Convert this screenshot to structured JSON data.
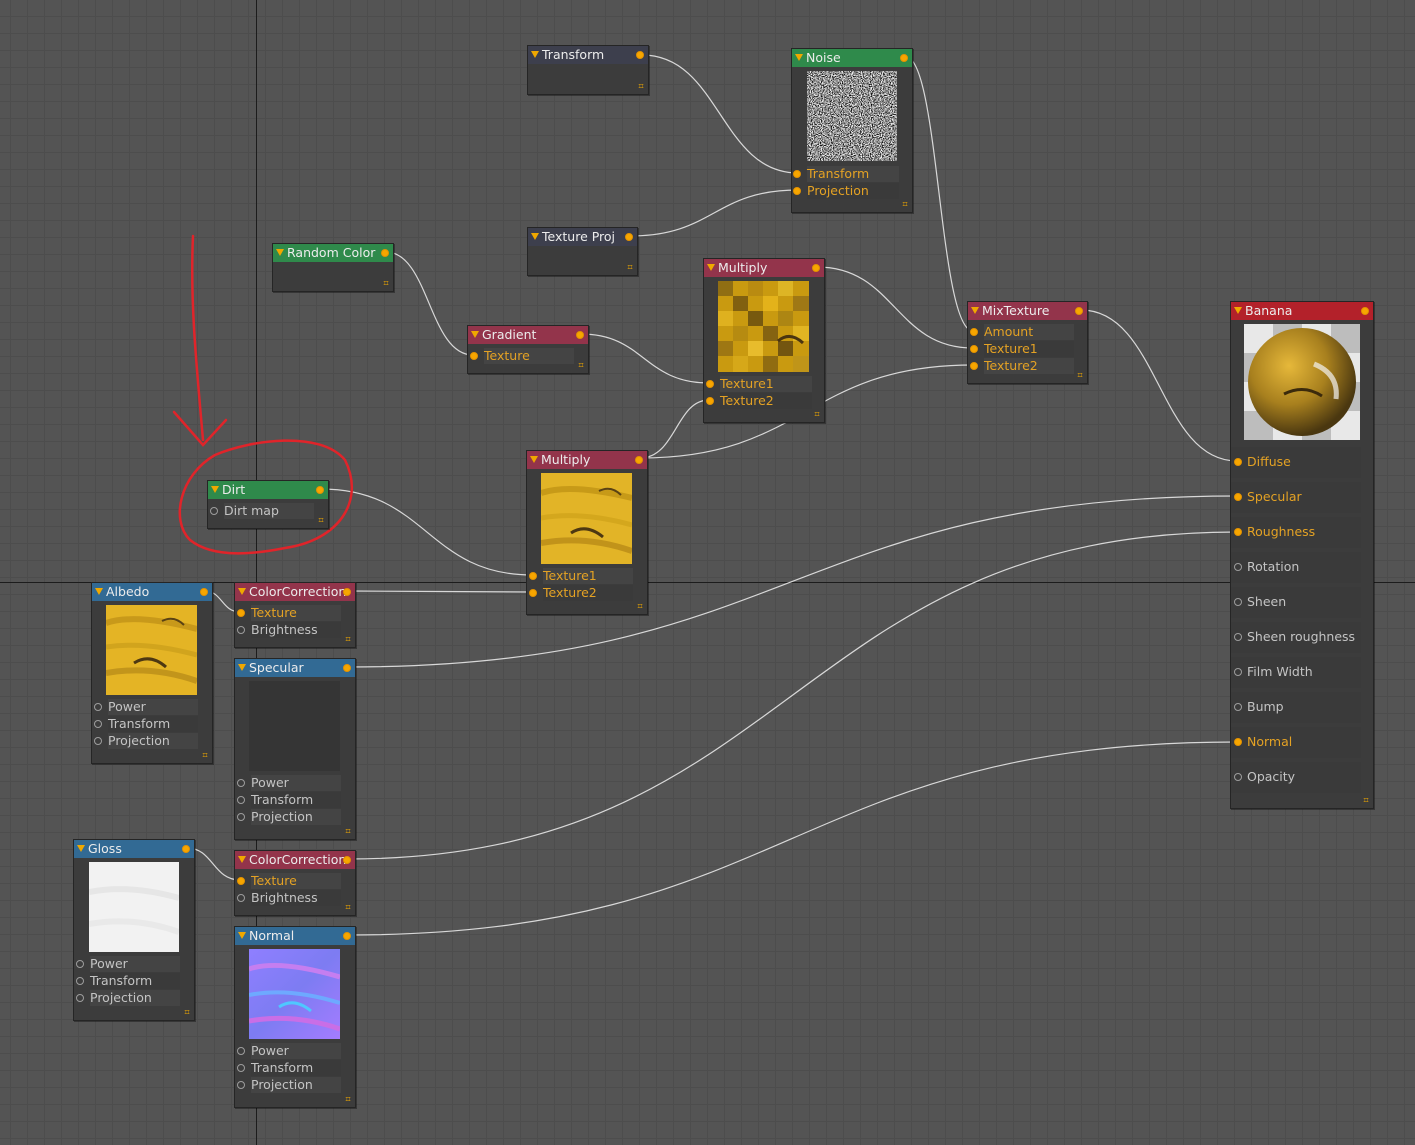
{
  "nodes": {
    "transform": {
      "title": "Transform"
    },
    "noise": {
      "title": "Noise",
      "ports": [
        "Transform",
        "Projection"
      ]
    },
    "texture_proj": {
      "title": "Texture Proj"
    },
    "random_color": {
      "title": "Random Color"
    },
    "gradient": {
      "title": "Gradient",
      "ports": [
        "Texture"
      ]
    },
    "multiply_top": {
      "title": "Multiply",
      "ports": [
        "Texture1",
        "Texture2"
      ]
    },
    "mix_texture": {
      "title": "MixTexture",
      "ports": [
        "Amount",
        "Texture1",
        "Texture2"
      ]
    },
    "dirt": {
      "title": "Dirt",
      "ports": [
        "Dirt map"
      ]
    },
    "multiply_mid": {
      "title": "Multiply",
      "ports": [
        "Texture1",
        "Texture2"
      ]
    },
    "albedo": {
      "title": "Albedo",
      "ports": [
        "Power",
        "Transform",
        "Projection"
      ]
    },
    "color_correction_1": {
      "title": "ColorCorrection",
      "ports": [
        "Texture",
        "Brightness"
      ]
    },
    "specular": {
      "title": "Specular",
      "ports": [
        "Power",
        "Transform",
        "Projection"
      ]
    },
    "gloss": {
      "title": "Gloss",
      "ports": [
        "Power",
        "Transform",
        "Projection"
      ]
    },
    "color_correction_2": {
      "title": "ColorCorrection",
      "ports": [
        "Texture",
        "Brightness"
      ]
    },
    "normal": {
      "title": "Normal",
      "ports": [
        "Power",
        "Transform",
        "Projection"
      ]
    },
    "banana": {
      "title": "Banana",
      "ports": [
        "Diffuse",
        "Specular",
        "Roughness",
        "Rotation",
        "Sheen",
        "Sheen roughness",
        "Film Width",
        "Bump",
        "Normal",
        "Opacity"
      ]
    }
  },
  "colors": {
    "canvas_bg": "#545454",
    "node_body": "#3c3c3c",
    "header_slate": "#3d3f4d",
    "header_green": "#2f8a4b",
    "header_red": "#93344b",
    "header_blue": "#326a94",
    "header_material": "#b3212a",
    "port_accent": "#f7a600",
    "annotation": "#e0242a"
  },
  "icons": {
    "collapse": "collapse-triangle-icon",
    "output": "output-socket-icon",
    "resize": "resize-grip-icon"
  }
}
